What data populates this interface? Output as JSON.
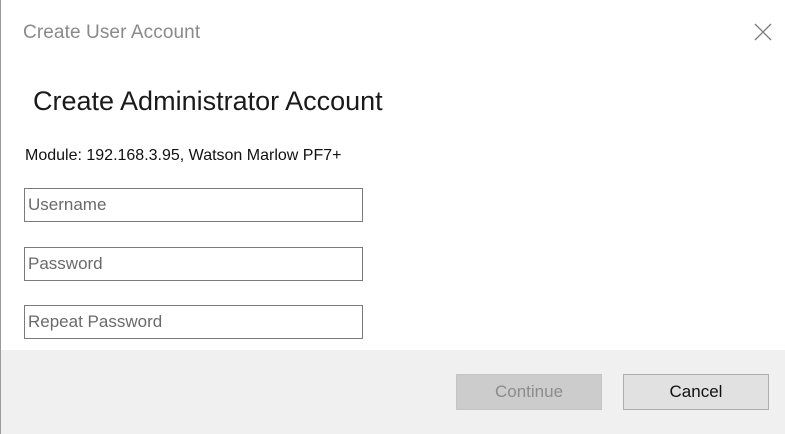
{
  "window": {
    "title": "Create User Account",
    "close_icon": "close-icon"
  },
  "content": {
    "heading": "Create Administrator Account",
    "module_line": "Module: 192.168.3.95, Watson Marlow PF7+"
  },
  "form": {
    "username": {
      "value": "",
      "placeholder": "Username"
    },
    "password": {
      "value": "",
      "placeholder": "Password"
    },
    "repeat_password": {
      "value": "",
      "placeholder": "Repeat Password"
    }
  },
  "buttons": {
    "continue_label": "Continue",
    "continue_enabled": false,
    "cancel_label": "Cancel"
  },
  "colors": {
    "title_text": "#8a8a8a",
    "footer_bg": "#f0f0f0",
    "disabled_button_bg": "#cccccc",
    "button_bg": "#e1e1e1"
  }
}
